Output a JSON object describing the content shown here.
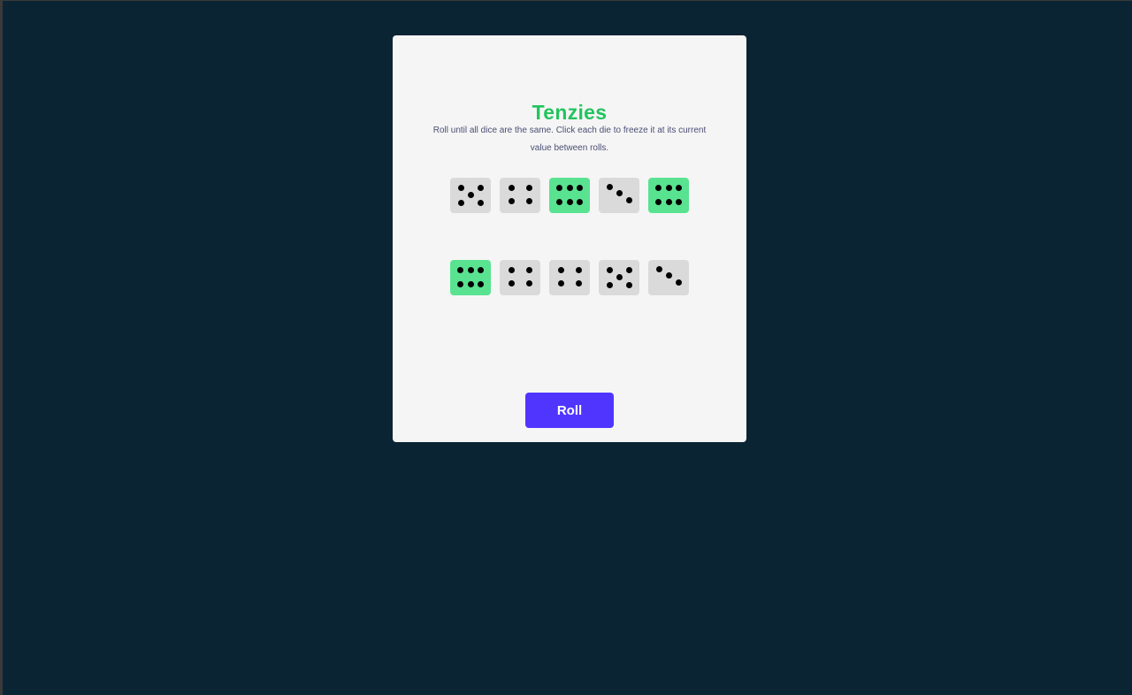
{
  "game": {
    "title": "Tenzies",
    "instructions": "Roll until all dice are the same. Click each die to freeze it at its current value between rolls.",
    "roll_label": "Roll"
  },
  "colors": {
    "background": "#0B2434",
    "card": "#F5F5F5",
    "title": "#23C45E",
    "die": "#DADADA",
    "die_held": "#59E391",
    "button": "#5035FF"
  },
  "dice": [
    {
      "value": 5,
      "held": false
    },
    {
      "value": 4,
      "held": false
    },
    {
      "value": 6,
      "held": true
    },
    {
      "value": 3,
      "held": false
    },
    {
      "value": 6,
      "held": true
    },
    {
      "value": 6,
      "held": true
    },
    {
      "value": 4,
      "held": false
    },
    {
      "value": 4,
      "held": false
    },
    {
      "value": 5,
      "held": false
    },
    {
      "value": 3,
      "held": false
    }
  ]
}
